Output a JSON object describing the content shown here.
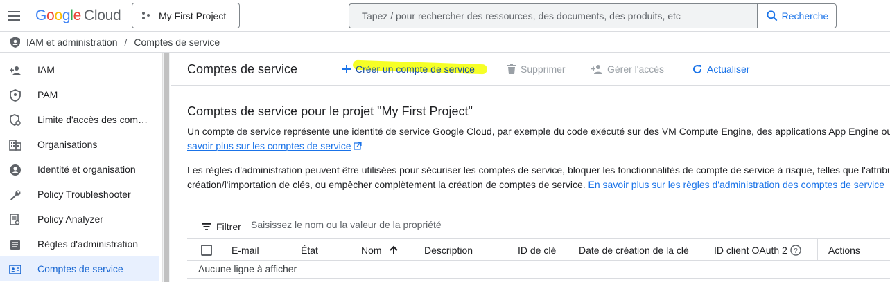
{
  "header": {
    "logo_google_letters": [
      "G",
      "o",
      "o",
      "g",
      "l",
      "e"
    ],
    "logo_cloud": "Cloud",
    "project_label": "My First Project",
    "search_placeholder": "Tapez / pour rechercher des ressources, des documents, des produits, etc",
    "search_button": "Recherche"
  },
  "breadcrumb": {
    "section": "IAM et administration",
    "separator": "/",
    "page": "Comptes de service"
  },
  "sidebar": {
    "items": [
      {
        "label": "IAM",
        "icon": "person-add-icon"
      },
      {
        "label": "PAM",
        "icon": "shield-icon"
      },
      {
        "label": "Limite d'accès des com…",
        "icon": "access-boundary-icon"
      },
      {
        "label": "Organisations",
        "icon": "building-icon"
      },
      {
        "label": "Identité et organisation",
        "icon": "account-circle-icon"
      },
      {
        "label": "Policy Troubleshooter",
        "icon": "wrench-icon"
      },
      {
        "label": "Policy Analyzer",
        "icon": "analyzer-icon"
      },
      {
        "label": "Règles d'administration",
        "icon": "list-doc-icon"
      },
      {
        "label": "Comptes de service",
        "icon": "service-account-icon",
        "active": true
      }
    ]
  },
  "toolbar": {
    "title": "Comptes de service",
    "create": "Créer un compte de service",
    "delete": "Supprimer",
    "manage_access": "Gérer l'accès",
    "refresh": "Actualiser"
  },
  "content": {
    "section_title": "Comptes de service pour le projet \"My First Project\"",
    "para1_line1": "Un compte de service représente une identité de service Google Cloud, par exemple du code exécuté sur des VM Compute Engine, des applications App Engine ou d",
    "para1_link": "savoir plus sur les comptes de service",
    "para2_line1": "Les règles d'administration peuvent être utilisées pour sécuriser les comptes de service, bloquer les fonctionnalités de compte de service à risque, telles que l'attribu",
    "para2_line2": "création/l'importation de clés, ou empêcher complètement la création de comptes de service.",
    "para2_link": "En savoir plus sur les règles d'administration des comptes de service"
  },
  "filter": {
    "label": "Filtrer",
    "placeholder": "Saisissez le nom ou la valeur de la propriété"
  },
  "table": {
    "columns": [
      "E-mail",
      "État",
      "Nom",
      "Description",
      "ID de clé",
      "Date de création de la clé",
      "ID client OAuth 2",
      "Actions"
    ],
    "empty_text": "Aucune ligne à afficher"
  },
  "colors": {
    "accent": "#1a73e8",
    "active_bg": "#e8f0fe",
    "highlight": "#f5ff00"
  }
}
